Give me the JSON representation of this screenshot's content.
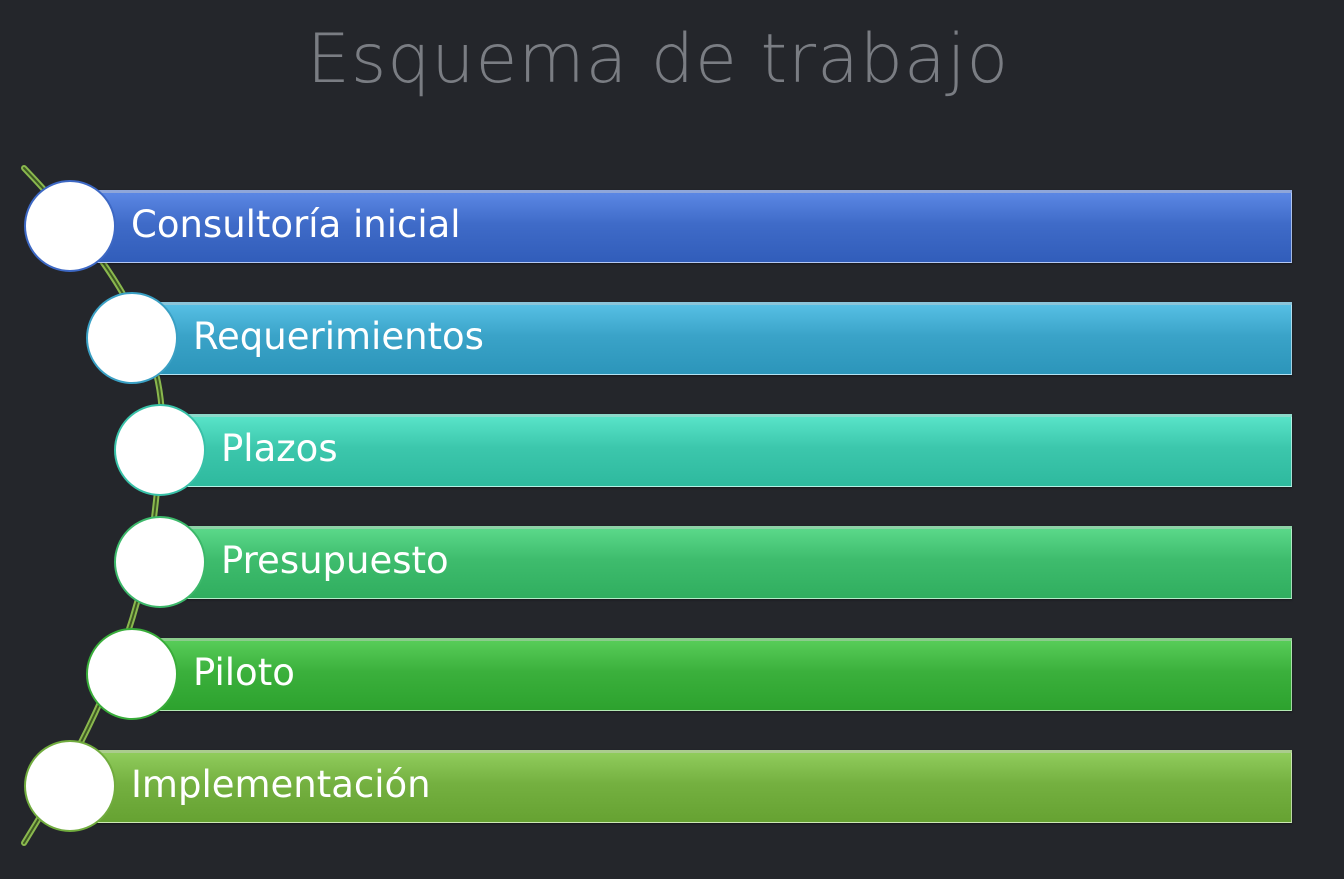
{
  "title": "Esquema de trabajo",
  "steps": [
    {
      "label": "Consultoría inicial",
      "color": "#3f6bc8",
      "node_border": "#3d68c4"
    },
    {
      "label": "Requerimientos",
      "color": "#3aa3c8",
      "node_border": "#3aa0c4"
    },
    {
      "label": "Plazos",
      "color": "#3cc7ac",
      "node_border": "#38c1a8"
    },
    {
      "label": "Presupuesto",
      "color": "#3ebc6d",
      "node_border": "#3cb86a"
    },
    {
      "label": "Piloto",
      "color": "#3bb03c",
      "node_border": "#39ad3a"
    },
    {
      "label": "Implementación",
      "color": "#74b040",
      "node_border": "#71ac3e"
    }
  ],
  "connector_color": "#6f9a3c"
}
